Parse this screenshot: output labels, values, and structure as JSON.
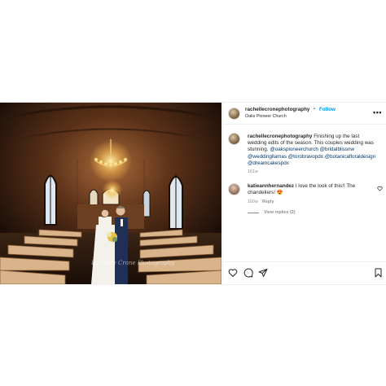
{
  "photo": {
    "watermark": "Rachelle Crone Photography"
  },
  "header": {
    "username": "rachellecronephotography",
    "separator": "•",
    "follow_label": "Follow",
    "location": "Oaks Pioneer Church",
    "more_icon": "more-horizontal-icon"
  },
  "caption": {
    "username": "rachellecronephotography",
    "text_part1": "Finishing up the last wedding edits of the season. This couples wedding was stunning.",
    "mentions_line1": "@oakspioneerchurch @bridalblissnw",
    "mentions_line2": "@weddingllamas @torobravopdx",
    "mentions_line3": "@botanicafloraldesign @dreamcakespdx",
    "age": "161w"
  },
  "comment": {
    "username": "katieannhernandez",
    "text": "I love the look of this!! The chandeliers!",
    "emoji": "😍",
    "age": "160w",
    "reply_label": "Reply",
    "view_replies_label": "View replies (2)",
    "like_icon": "heart-outline-icon"
  },
  "actions": {
    "like_icon": "heart-outline-icon",
    "comment_icon": "comment-bubble-icon",
    "share_icon": "paper-plane-icon",
    "save_icon": "bookmark-icon"
  }
}
